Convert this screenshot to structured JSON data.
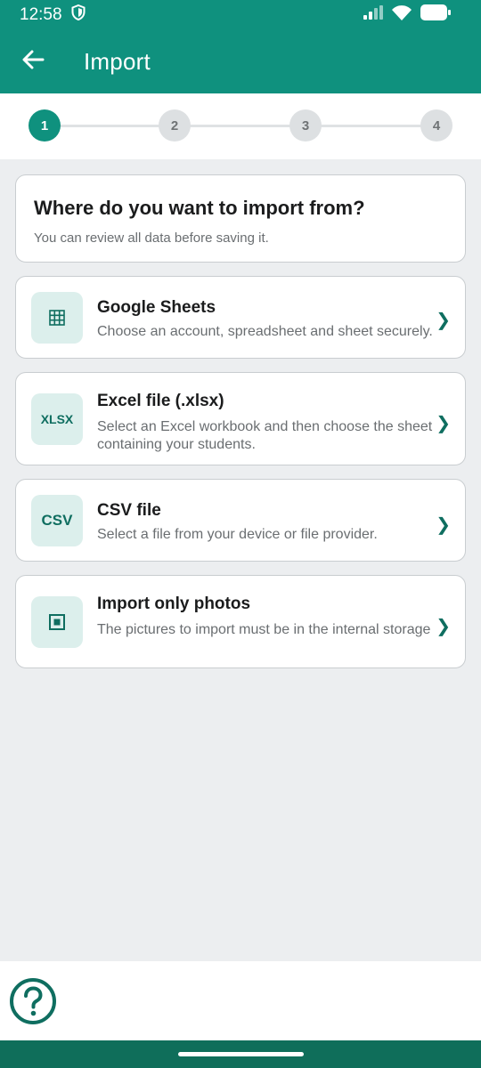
{
  "status": {
    "time": "12:58"
  },
  "appbar": {
    "title": "Import"
  },
  "stepper": {
    "steps": [
      "1",
      "2",
      "3",
      "4"
    ],
    "active_step": 1
  },
  "intro": {
    "heading": "Where do you want to import from?",
    "subtitle": "You can review all data before saving it."
  },
  "options": [
    {
      "icon": "grid-icon",
      "icon_text": "",
      "title": "Google Sheets",
      "description": "Choose an account, spreadsheet and sheet securely."
    },
    {
      "icon": "xlsx-icon",
      "icon_text": "XLSX",
      "title": "Excel file (.xlsx)",
      "description": "Select an Excel workbook and then choose the sheet containing your students."
    },
    {
      "icon": "csv-icon",
      "icon_text": "CSV",
      "title": "CSV file",
      "description": "Select a file from your device or file provider."
    },
    {
      "icon": "photo-icon",
      "icon_text": "",
      "title": "Import only photos",
      "description": "The pictures to import must be in the internal storage"
    }
  ],
  "colors": {
    "primary": "#0F917E",
    "accent_dark": "#0F6E60",
    "icon_bg": "#DCEFEC",
    "background": "#ECEEF0"
  }
}
